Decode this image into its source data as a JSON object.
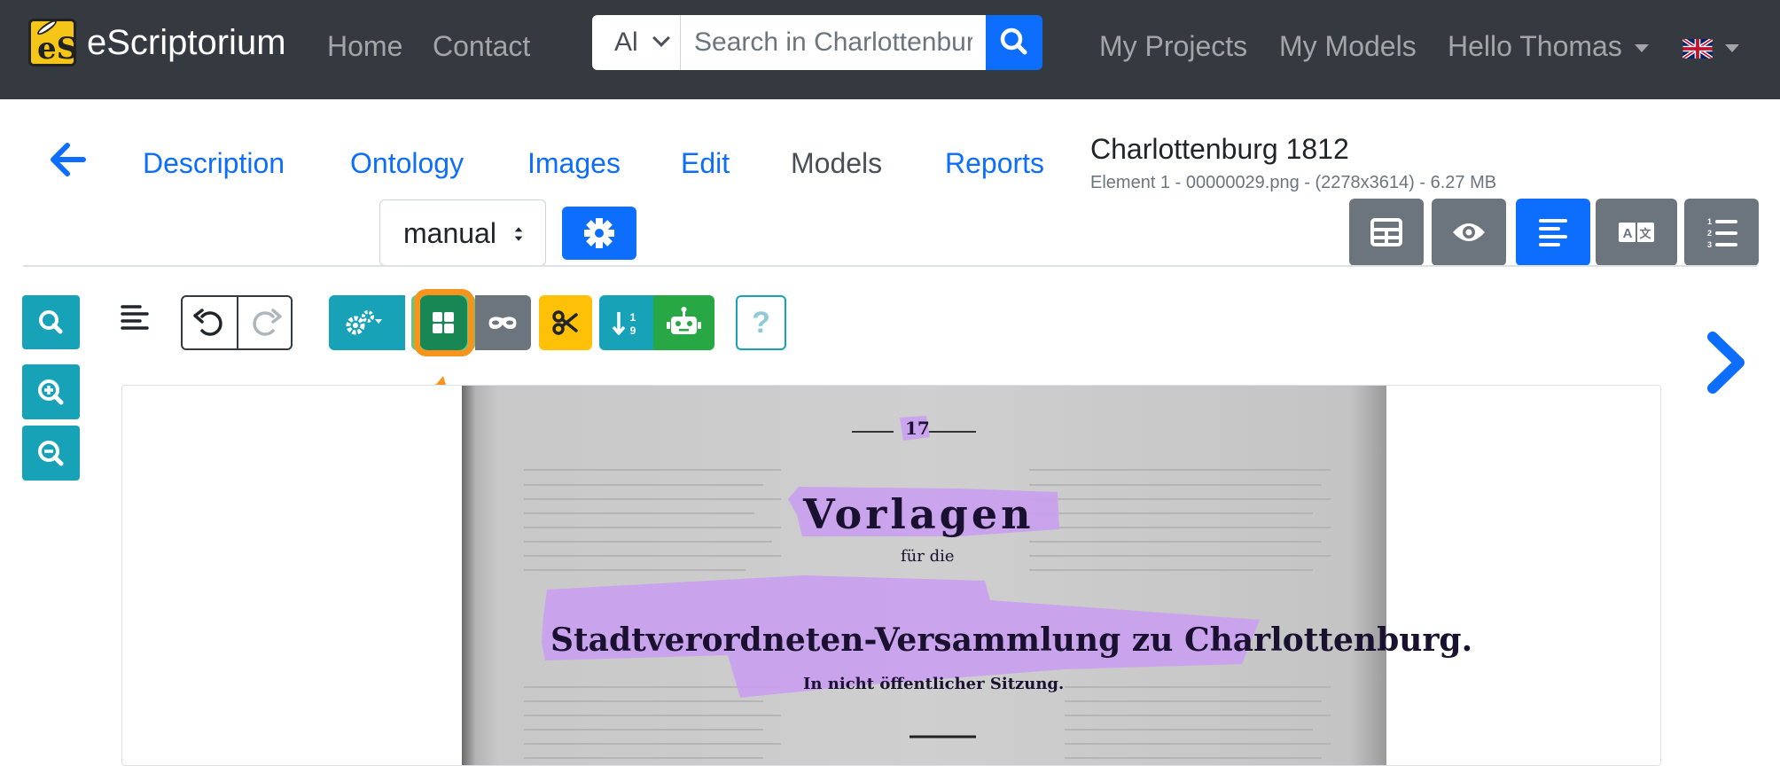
{
  "navbar": {
    "brand": "eScriptorium",
    "links": [
      "Home",
      "Contact"
    ],
    "search": {
      "scope": "Al",
      "placeholder": "Search in Charlottenburg"
    },
    "right_links": [
      "My Projects",
      "My Models",
      "Hello Thomas"
    ]
  },
  "doc_nav": {
    "tabs": [
      "Description",
      "Ontology",
      "Images",
      "Edit",
      "Models",
      "Reports"
    ],
    "active_tab": "Models",
    "title": "Charlottenburg 1812",
    "meta": "Element 1 - 00000029.png - (2278x3614) - 6.27 MB",
    "transcription_select": "manual"
  },
  "page_text": {
    "page_number": "17",
    "heading": "Vorlagen",
    "sub": "für die",
    "main": "Stadtverordneten-Versammlung zu Charlottenburg.",
    "note": "In nicht öffentlicher Sitzung."
  },
  "colors": {
    "navbar": "#343a40",
    "primary": "#0d6efd",
    "info": "#17a2b8",
    "success": "#198754",
    "warning": "#ffc107",
    "secondary": "#6c757d",
    "region_overlay": "#c9a0f0",
    "annotation": "#f7941d"
  },
  "icons": [
    "search-icon",
    "zoom-in-icon",
    "zoom-out-icon",
    "undo-icon",
    "redo-icon",
    "gears-icon",
    "segment-grid-icon",
    "mask-icon",
    "scissors-icon",
    "sort-icon",
    "robot-icon",
    "help-icon",
    "table-icon",
    "eye-icon",
    "align-left-icon",
    "translate-icon",
    "list-ol-icon",
    "chevron-right-icon",
    "back-arrow-icon"
  ]
}
